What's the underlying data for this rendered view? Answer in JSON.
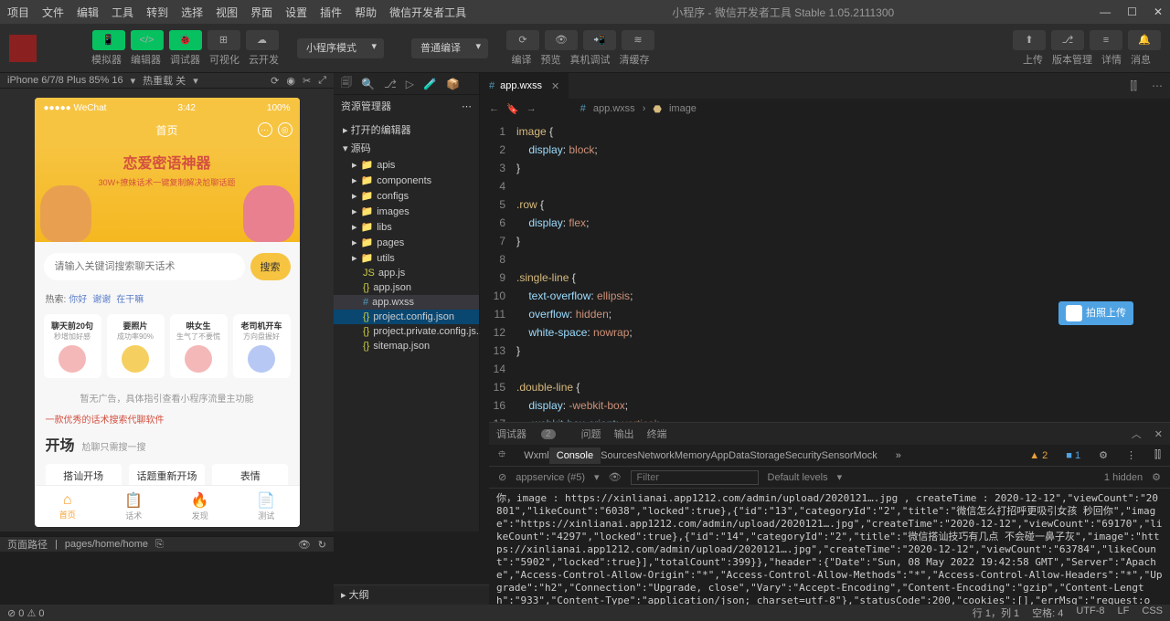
{
  "menu": [
    "项目",
    "文件",
    "编辑",
    "工具",
    "转到",
    "选择",
    "视图",
    "界面",
    "设置",
    "插件",
    "帮助",
    "微信开发者工具"
  ],
  "title": "小程序 - 微信开发者工具 Stable 1.05.2111300",
  "toolbar": {
    "labels": [
      "模拟器",
      "编辑器",
      "调试器",
      "可视化",
      "云开发"
    ],
    "mode": "小程序模式",
    "compile": "普通编译",
    "c_labels": [
      "编译",
      "预览",
      "真机调试",
      "清缓存"
    ],
    "r_labels": [
      "上传",
      "版本管理",
      "详情",
      "消息"
    ]
  },
  "sim": {
    "device": "iPhone 6/7/8 Plus 85% 16",
    "reload": "热重载 关"
  },
  "phone": {
    "carrier": "●●●●● WeChat",
    "time": "3:42",
    "battery": "100%",
    "nav_title": "首页",
    "banner_title": "恋爱密语神器",
    "banner_sub": "30W+撩妹话术一键复制解决尬聊话题",
    "search_ph": "请输入关键词搜索聊天话术",
    "search_btn": "搜索",
    "hot_label": "热索:",
    "hot_links": [
      "你好",
      "谢谢",
      "在干嘛"
    ],
    "cards": [
      {
        "t": "聊天前20句",
        "s": "秒增加好感",
        "c": "#f4b8b8"
      },
      {
        "t": "要照片",
        "s": "成功率90%",
        "c": "#f5d060"
      },
      {
        "t": "哄女生",
        "s": "生气了不要慌",
        "c": "#f4b8b8"
      },
      {
        "t": "老司机开车",
        "s": "方向盘握好",
        "c": "#b8c8f4"
      }
    ],
    "notice": "暂无广告，具体指引查看小程序流量主功能",
    "red_text": "一款优秀的话术搜索代聊软件",
    "section_t": "开场",
    "section_s": "尬聊只需搜一搜",
    "pills": [
      "搭讪开场",
      "话题重新开场",
      "表情"
    ],
    "tabs": [
      "首页",
      "话术",
      "发现",
      "测试"
    ]
  },
  "explorer": {
    "title": "资源管理器",
    "items": [
      {
        "label": "打开的编辑器",
        "l": 1,
        "arrow": "▸"
      },
      {
        "label": "源码",
        "l": 1,
        "arrow": "▾"
      },
      {
        "label": "apis",
        "l": 2,
        "arrow": "▸",
        "ic": "folder"
      },
      {
        "label": "components",
        "l": 2,
        "arrow": "▸",
        "ic": "folder"
      },
      {
        "label": "configs",
        "l": 2,
        "arrow": "▸",
        "ic": "folder"
      },
      {
        "label": "images",
        "l": 2,
        "arrow": "▸",
        "ic": "folder"
      },
      {
        "label": "libs",
        "l": 2,
        "arrow": "▸",
        "ic": "folder"
      },
      {
        "label": "pages",
        "l": 2,
        "arrow": "▸",
        "ic": "folder"
      },
      {
        "label": "utils",
        "l": 2,
        "arrow": "▸",
        "ic": "folder"
      },
      {
        "label": "app.js",
        "l": 3,
        "ic": "js"
      },
      {
        "label": "app.json",
        "l": 3,
        "ic": "json"
      },
      {
        "label": "app.wxss",
        "l": 3,
        "ic": "wxss",
        "sel": true
      },
      {
        "label": "project.config.json",
        "l": 3,
        "ic": "json",
        "sel2": true
      },
      {
        "label": "project.private.config.js...",
        "l": 3,
        "ic": "json"
      },
      {
        "label": "sitemap.json",
        "l": 3,
        "ic": "json"
      }
    ]
  },
  "editor": {
    "tab": "app.wxss",
    "crumb1": "app.wxss",
    "crumb2": "image",
    "hint": "拍照上传",
    "code": [
      {
        "n": 1,
        "sel": "image",
        "b": "{"
      },
      {
        "n": 2,
        "prop": "display",
        "val": "block"
      },
      {
        "n": 3,
        "b": "}"
      },
      {
        "n": 4
      },
      {
        "n": 5,
        "sel": ".row",
        "b": "{"
      },
      {
        "n": 6,
        "prop": "display",
        "val": "flex"
      },
      {
        "n": 7,
        "b": "}"
      },
      {
        "n": 8
      },
      {
        "n": 9,
        "sel": ".single-line",
        "b": "{"
      },
      {
        "n": 10,
        "prop": "text-overflow",
        "val": "ellipsis"
      },
      {
        "n": 11,
        "prop": "overflow",
        "val": "hidden"
      },
      {
        "n": 12,
        "prop": "white-space",
        "val": "nowrap"
      },
      {
        "n": 13,
        "b": "}"
      },
      {
        "n": 14
      },
      {
        "n": 15,
        "sel": ".double-line",
        "b": "{"
      },
      {
        "n": 16,
        "prop": "display",
        "val": "-webkit-box"
      },
      {
        "n": 17,
        "prop": "-webkit-box-orient",
        "val": "vertical",
        "dim": true
      }
    ]
  },
  "debugger": {
    "tabs_l": "调试器",
    "tabs_badge": "2",
    "tabs": [
      "问题",
      "输出",
      "终端"
    ],
    "dev": [
      "Wxml",
      "Console",
      "Sources",
      "Network",
      "Memory",
      "AppData",
      "Storage",
      "Security",
      "Sensor",
      "Mock"
    ],
    "warn": "▲ 2",
    "info": "■ 1",
    "context": "appservice (#5)",
    "filter_ph": "Filter",
    "levels": "Default levels",
    "hidden": "1 hidden",
    "log": "你，image : https://xinlianai.app1212.com/admin/upload/2020121….jpg , createTime : 2020-12-12\",\"viewCount\":\"20801\",\"likeCount\":\"6038\",\"locked\":true},{\"id\":\"13\",\"categoryId\":\"2\",\"title\":\"微信怎么打招呼更吸引女孩 秒回你\",\"image\":\"https://xinlianai.app1212.com/admin/upload/2020121….jpg\",\"createTime\":\"2020-12-12\",\"viewCount\":\"69170\",\"likeCount\":\"4297\",\"locked\":true},{\"id\":\"14\",\"categoryId\":\"2\",\"title\":\"微信搭讪技巧有几点 不会碰一鼻子灰\",\"image\":\"https://xinlianai.app1212.com/admin/upload/2020121….jpg\",\"createTime\":\"2020-12-12\",\"viewCount\":\"63784\",\"likeCount\":\"5902\",\"locked\":true}],\"totalCount\":399}},\"header\":{\"Date\":\"Sun, 08 May 2022 19:42:58 GMT\",\"Server\":\"Apache\",\"Access-Control-Allow-Origin\":\"*\",\"Access-Control-Allow-Methods\":\"*\",\"Access-Control-Allow-Headers\":\"*\",\"Upgrade\":\"h2\",\"Connection\":\"Upgrade, close\",\"Vary\":\"Accept-Encoding\",\"Content-Encoding\":\"gzip\",\"Content-Length\":\"933\",\"Content-Type\":\"application/json; charset=utf-8\"},\"statusCode\":200,\"cookies\":[],\"errMsg\":\"request:ok\"}"
  },
  "outline": "大纲",
  "status": {
    "path_l": "页面路径",
    "path": "pages/home/home",
    "errs": "⊘ 0 ⚠ 0",
    "pos": "行 1，列 1",
    "space": "空格: 4",
    "enc": "UTF-8",
    "eol": "LF",
    "lang": "CSS"
  }
}
